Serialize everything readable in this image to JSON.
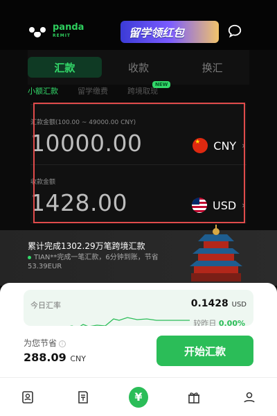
{
  "brand": {
    "name": "panda",
    "sub": "REMIT",
    "accent": "#33d96a"
  },
  "promo": {
    "label": "留学领红包"
  },
  "tabs": [
    {
      "label": "汇款"
    },
    {
      "label": "收款"
    },
    {
      "label": "换汇"
    }
  ],
  "subtabs": [
    {
      "label": "小额汇款"
    },
    {
      "label": "留学缴费"
    },
    {
      "label": "跨境取现"
    }
  ],
  "new_badge": "NEW",
  "send": {
    "label": "汇款金额(100.00 ~ 49000.00 CNY)",
    "amount": "10000.00",
    "currency": "CNY",
    "chevron": "›"
  },
  "receive": {
    "label": "收款金额",
    "amount": "1428.00",
    "currency": "USD",
    "chevron": "›"
  },
  "banner": {
    "headline": "累计完成1302.29万笔跨境汇款",
    "detail": "TIAN**完成一笔汇款，6分钟到账，节省53.39EUR"
  },
  "rate": {
    "label": "今日汇率",
    "value": "0.1428",
    "unit": "USD",
    "compare_label": "较昨日",
    "compare_value": "0.00%"
  },
  "savings": {
    "label": "为您节省",
    "info": "i",
    "amount": "288.09",
    "currency": "CNY"
  },
  "cta": {
    "label": "开始汇款"
  },
  "bottom_nav": {
    "items": [
      "contacts-icon",
      "bill-icon",
      "yuan-icon",
      "gift-icon",
      "profile-icon"
    ],
    "center_symbol": "¥"
  }
}
